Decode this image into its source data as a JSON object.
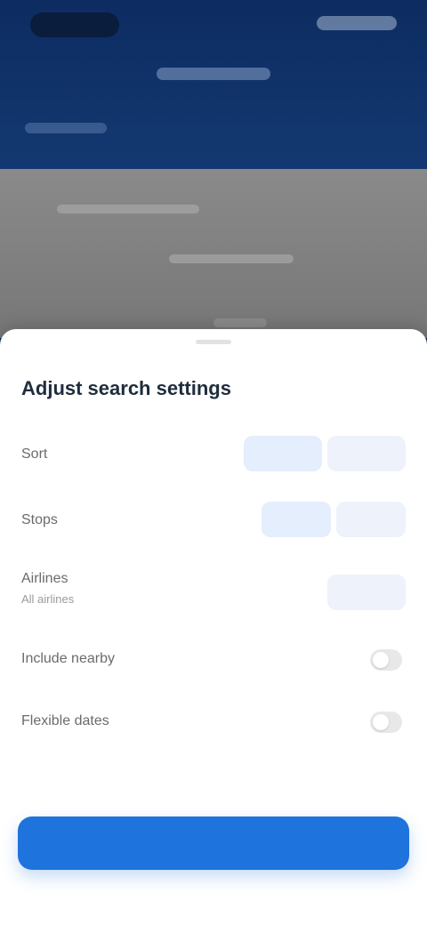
{
  "status_bar": {
    "time": "",
    "right_indicators": ""
  },
  "header": {
    "title": "",
    "subtitle": ""
  },
  "background_card": {
    "lines": [
      "",
      "",
      ""
    ]
  },
  "sheet": {
    "title": "Adjust search settings",
    "rows": [
      {
        "label": "Sort",
        "options": [
          "",
          ""
        ]
      },
      {
        "label": "Stops",
        "options": [
          "",
          ""
        ]
      },
      {
        "label": "Airlines",
        "sublabel": "All airlines",
        "options": [
          ""
        ]
      },
      {
        "label": "Include nearby",
        "toggle": false
      },
      {
        "label": "Flexible dates",
        "toggle": false
      }
    ],
    "link_text": "",
    "primary_button": ""
  },
  "colors": {
    "accent": "#1f73dd",
    "header_bg": "#0d2c61"
  }
}
